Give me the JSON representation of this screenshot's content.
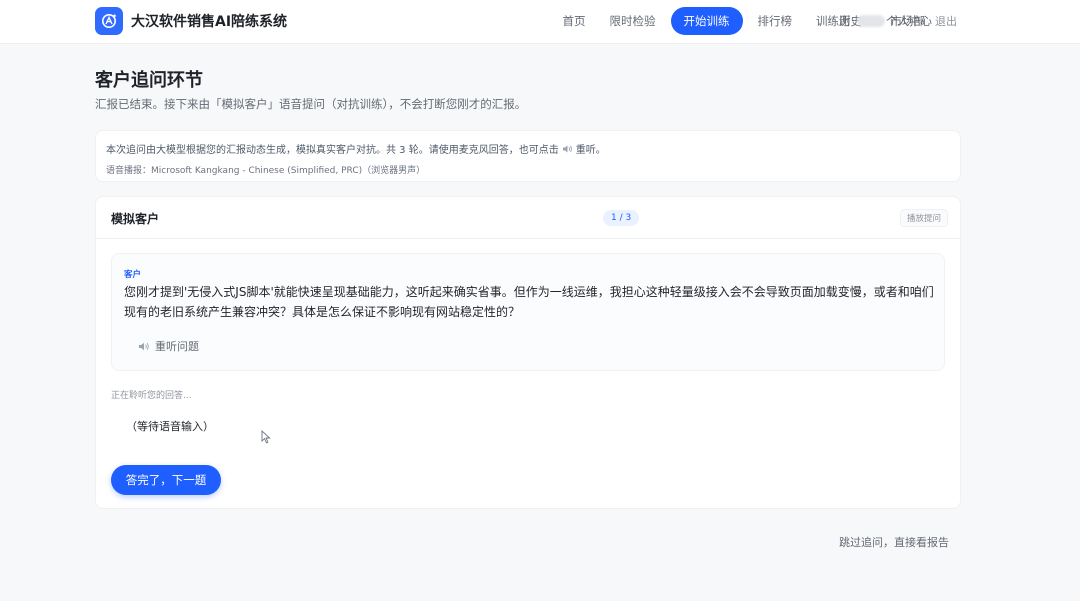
{
  "header": {
    "app_title": "大汉软件销售AI陪练系统",
    "logo_icon": "ai-logo-icon",
    "nav": [
      {
        "label": "首页",
        "active": false
      },
      {
        "label": "限时检验",
        "active": false
      },
      {
        "label": "开始训练",
        "active": true
      },
      {
        "label": "排行榜",
        "active": false
      },
      {
        "label": "训练历史",
        "active": false
      },
      {
        "label": "个人中心",
        "active": false
      }
    ],
    "user_surname": "谢",
    "department": "市场部",
    "logout_label": "退出"
  },
  "page": {
    "title": "客户追问环节",
    "subtitle": "汇报已结束。接下来由「模拟客户」语音提问（对抗训练），不会打断您刚才的汇报。"
  },
  "info": {
    "line1_prefix": "本次追问由大模型根据您的汇报动态生成，模拟真实客户对抗。共 3 轮。请使用麦克风回答，也可点击",
    "line1_suffix": "重听。",
    "speaker_icon": "speaker-icon",
    "voice_line": "语音播报：Microsoft Kangkang - Chinese (Simplified, PRC)（浏览器男声）"
  },
  "conversation": {
    "card_title": "模拟客户",
    "progress": "1 / 3",
    "voice_toggle_label": "播放提问",
    "role_label": "客户",
    "question": "您刚才提到'无侵入式JS脚本'就能快速呈现基础能力，这听起来确实省事。但作为一线运维，我担心这种轻量级接入会不会导致页面加载变慢，或者和咱们\n现有的老旧系统产生兼容冲突？具体是怎么保证不影响现有网站稳定性的？",
    "replay_label": "重听问题",
    "listening_label": "正在聆听您的回答...",
    "waiting_label": "（等待语音输入）",
    "done_button": "答完了，下一题"
  },
  "footer": {
    "skip_label": "跳过追问，直接看报告"
  },
  "colors": {
    "accent": "#1f5fff",
    "background": "#f7f8fa"
  }
}
